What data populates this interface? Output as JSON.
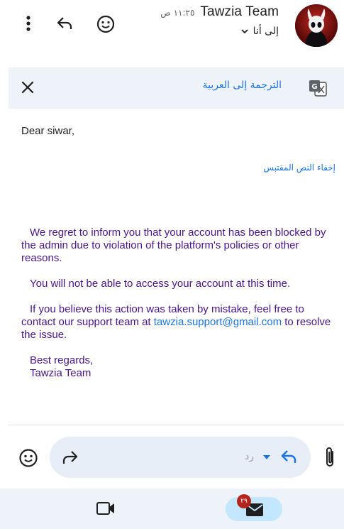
{
  "header": {
    "sender_name": "Tawzia Team",
    "time": "١١:٢٥ ص",
    "recipient": "إلى أنا"
  },
  "translate_bar": {
    "label": "الترجمة إلى العربية"
  },
  "message": {
    "greeting": "Dear siwar,",
    "hide_quoted": "إخفاء النص المقتبس",
    "paragraph_1": "We regret to inform you that your account has been blocked by the admin due to violation of the platform's policies or other reasons.",
    "paragraph_2": "You will not be able to access your account at this time.",
    "paragraph_3_start": "If you believe this action was taken by mistake, feel free to contact our support team at ",
    "support_email": "tawzia.support@gmail.com",
    "paragraph_3_end": " to resolve the issue.",
    "signoff": "Best regards,",
    "signature": "Tawzia Team"
  },
  "reply_bar": {
    "reply_label": "رد"
  },
  "bottom_nav": {
    "mail_badge": "٢٩"
  },
  "colors": {
    "accent": "#1a73e8",
    "body_text": "#4a148c",
    "badge": "#b3261e",
    "translate_bar_bg": "#eef2f9",
    "mail_pill_bg": "#c2e7ff"
  },
  "icons": [
    "more-vert-icon",
    "reply-icon",
    "emoji-icon",
    "chevron-down-icon",
    "close-icon",
    "google-translate-icon",
    "forward-icon",
    "dropdown-arrow-icon",
    "attachment-icon",
    "video-icon",
    "mail-icon"
  ]
}
